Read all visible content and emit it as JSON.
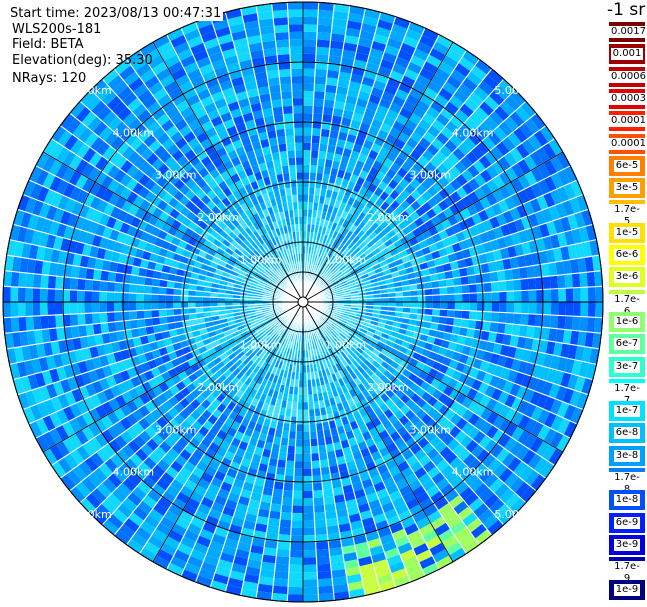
{
  "header": {
    "start_time": "Start time: 2023/08/13 00:47:31",
    "instrument": "WLS200s-181",
    "field": "Field: BETA",
    "elevation": "Elevation(deg): 35.30",
    "nrays": "NRays: 120"
  },
  "colorbar": {
    "title": "-1 sr",
    "labels": [
      "0.0017",
      "0.001",
      "0.0006",
      "0.0003",
      "0.00017",
      "0.0001",
      "6e-5",
      "3e-5",
      "1.7e-5",
      "1e-5",
      "6e-6",
      "3e-6",
      "1.7e-6",
      "1e-6",
      "6e-7",
      "3e-7",
      "1.7e-7",
      "1e-7",
      "6e-8",
      "3e-8",
      "1.7e-8",
      "1e-8",
      "6e-9",
      "3e-9",
      "1.7e-9",
      "1e-9"
    ],
    "colors": [
      "#7a0000",
      "#9a0000",
      "#c00000",
      "#e00000",
      "#ff2000",
      "#ff5000",
      "#ff8000",
      "#ffa000",
      "#ffc000",
      "#ffe000",
      "#ffff00",
      "#e0ff20",
      "#c0ff40",
      "#90ff70",
      "#60ffa0",
      "#30ffd0",
      "#00ffff",
      "#00e0ff",
      "#00c0ff",
      "#00a0ff",
      "#0080ff",
      "#0050ff",
      "#0020ff",
      "#0000e0",
      "#0000b0",
      "#000080"
    ]
  },
  "chart_data": {
    "type": "heatmap",
    "projection": "polar (PPI scan)",
    "field": "BETA",
    "units": "sr-1",
    "n_rays": 120,
    "elevation_deg": 35.3,
    "range_rings_labels": [
      "1.00km",
      "2.00km",
      "3.00km",
      "4.00km",
      "5.00km"
    ],
    "max_range_km": 5.8,
    "color_scale": "log",
    "value_range": [
      1e-09,
      0.0017
    ],
    "dominant_values": "mostly 1e-8 to 1e-7 (blue to cyan), lighter near center; higher (~1e-6 to 6e-6, green-yellow) at far south-southeast edge",
    "grid": "on"
  }
}
